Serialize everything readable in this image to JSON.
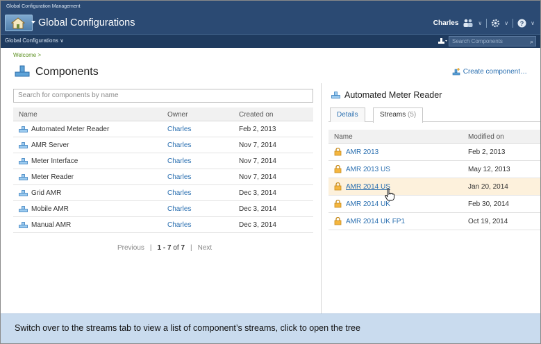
{
  "app": {
    "small_title": "Global Configuration Management",
    "title": "Global Configurations",
    "user": "Charles",
    "context_menu": "Global Configurations ∨",
    "search_placeholder": "Search Components"
  },
  "page": {
    "breadcrumb": "Welcome >",
    "title": "Components",
    "create_link": "Create component…"
  },
  "components": {
    "search_placeholder": "Search for components by name",
    "columns": [
      "Name",
      "Owner",
      "Created on"
    ],
    "rows": [
      {
        "name": "Automated Meter Reader",
        "owner": "Charles",
        "created": "Feb 2, 2013"
      },
      {
        "name": "AMR Server",
        "owner": "Charles",
        "created": "Nov 7, 2014"
      },
      {
        "name": "Meter Interface",
        "owner": "Charles",
        "created": "Nov 7, 2014"
      },
      {
        "name": "Meter Reader",
        "owner": "Charles",
        "created": "Nov 7, 2014"
      },
      {
        "name": "Grid AMR",
        "owner": "Charles",
        "created": "Dec 3, 2014"
      },
      {
        "name": "Mobile AMR",
        "owner": "Charles",
        "created": "Dec 3, 2014"
      },
      {
        "name": "Manual AMR",
        "owner": "Charles",
        "created": "Dec 3, 2014"
      }
    ],
    "pager": {
      "previous": "Previous",
      "sep": "|",
      "range": "1 - 7",
      "of": "of",
      "total": "7",
      "next": "Next"
    }
  },
  "detail": {
    "title": "Automated Meter Reader",
    "tabs": {
      "details": "Details",
      "streams": "Streams",
      "streams_count": "(5)"
    },
    "columns": [
      "Name",
      "Modified on"
    ],
    "streams": [
      {
        "name": "AMR 2013",
        "modified": "Feb 2, 2013"
      },
      {
        "name": "AMR 2013 US",
        "modified": "May 12, 2013"
      },
      {
        "name": "AMR 2014 US",
        "modified": "Jan 20, 2014"
      },
      {
        "name": "AMR 2014 UK",
        "modified": "Feb 30, 2014"
      },
      {
        "name": "AMR 2014 UK FP1",
        "modified": "Oct 19, 2014"
      }
    ]
  },
  "caption": "Switch over to the streams tab to view a list of component’s streams, click to open the tree",
  "colors": {
    "banner": "#2b4a73",
    "link": "#2a6fb0",
    "highlight_row": "#fdf1dc",
    "caption_bg": "#c9dbee"
  }
}
